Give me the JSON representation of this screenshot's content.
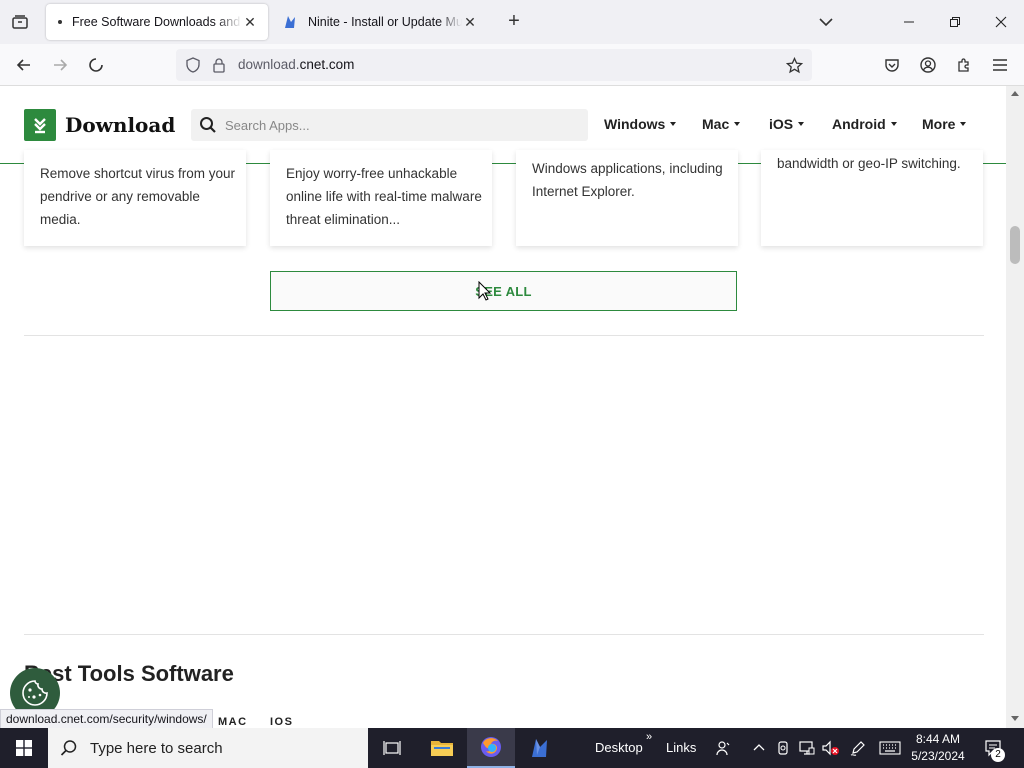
{
  "browser": {
    "tabs": [
      {
        "title": "Free Software Downloads and Reviews for Windows, Android, Mac, and iOS - CNET Download",
        "active": true,
        "loading": true
      },
      {
        "title": "Ninite - Install or Update Multiple Apps at Once",
        "active": false
      }
    ],
    "url_domain": "download.",
    "url_rest": "cnet.com"
  },
  "site": {
    "logo_text": "Download",
    "search_placeholder": "Search Apps...",
    "nav": [
      "Windows",
      "Mac",
      "iOS",
      "Android",
      "More"
    ]
  },
  "cards": [
    {
      "text": "Remove shortcut virus from your pendrive or any removable media."
    },
    {
      "text": "Enjoy worry-free unhackable online life with real-time malware threat elimination..."
    },
    {
      "text": "Windows applications, including Internet Explorer."
    },
    {
      "text": "bandwidth or geo-IP switching."
    }
  ],
  "see_all_label": "SEE ALL",
  "section": {
    "title": "Best Tools Software",
    "tabs": [
      "MAC",
      "IOS"
    ]
  },
  "status_bar_url": "download.cnet.com/security/windows/",
  "taskbar": {
    "search_placeholder": "Type here to search",
    "desktop_label": "Desktop",
    "links_label": "Links",
    "time": "8:44 AM",
    "date": "5/23/2024",
    "notification_count": "2"
  },
  "colors": {
    "brand_green": "#2d8a3e",
    "taskbar": "#1f1f2b"
  }
}
